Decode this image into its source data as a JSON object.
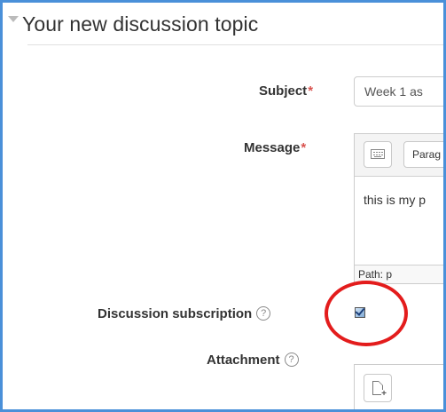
{
  "fieldset": {
    "title": "Your new discussion topic"
  },
  "form": {
    "subject": {
      "label": "Subject",
      "required_mark": "*",
      "value": "Week 1 as"
    },
    "message": {
      "label": "Message",
      "required_mark": "*",
      "format_select": "Parag",
      "body_text": "this is my p",
      "status_path": "Path: p"
    },
    "subscription": {
      "label": "Discussion subscription",
      "help_glyph": "?",
      "checked": true
    },
    "attachment": {
      "label": "Attachment",
      "help_glyph": "?"
    }
  },
  "colors": {
    "frame_border": "#4a90d9",
    "required": "#d9534f",
    "annotation_circle": "#e31c1c"
  },
  "icons": {
    "collapse": "triangle-down-icon",
    "toolbar_toggle": "keyboard-icon",
    "help": "question-circle-icon",
    "add_file": "add-file-icon"
  }
}
